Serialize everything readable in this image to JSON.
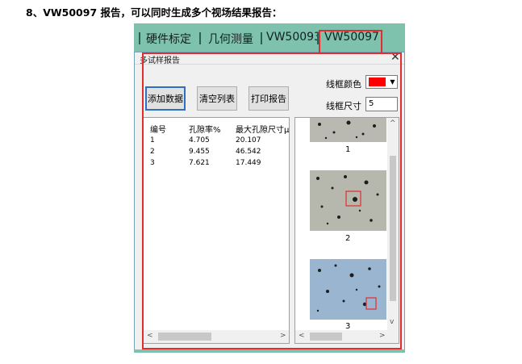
{
  "heading": "8、VW50097 报告，可以同时生成多个视场结果报告：",
  "tabs": [
    "硬件标定",
    "几何测量",
    "VW50093",
    "VW50097"
  ],
  "dialog": {
    "title": "多试样报告",
    "close": "✕",
    "buttons": {
      "add": "添加数据",
      "clear": "清空列表",
      "print": "打印报告"
    },
    "color_label": "线框颜色",
    "color_value": "#ff0000",
    "size_label": "线框尺寸",
    "size_value": "5"
  },
  "table": {
    "columns": [
      "编号",
      "孔隙率%",
      "最大孔隙尺寸μ"
    ],
    "rows": [
      [
        "1",
        "4.705",
        "20.107"
      ],
      [
        "2",
        "9.455",
        "46.542"
      ],
      [
        "3",
        "7.621",
        "17.449"
      ]
    ]
  },
  "images": {
    "captions": [
      "1",
      "2",
      "3"
    ]
  },
  "icons": {
    "dropdown": "▼",
    "left": "<",
    "right": ">",
    "up": "^",
    "down": "v"
  },
  "colors": {
    "tab_bar": "#7ec2ad",
    "highlight": "#e52b2b",
    "active_border": "#2e6fbf"
  }
}
